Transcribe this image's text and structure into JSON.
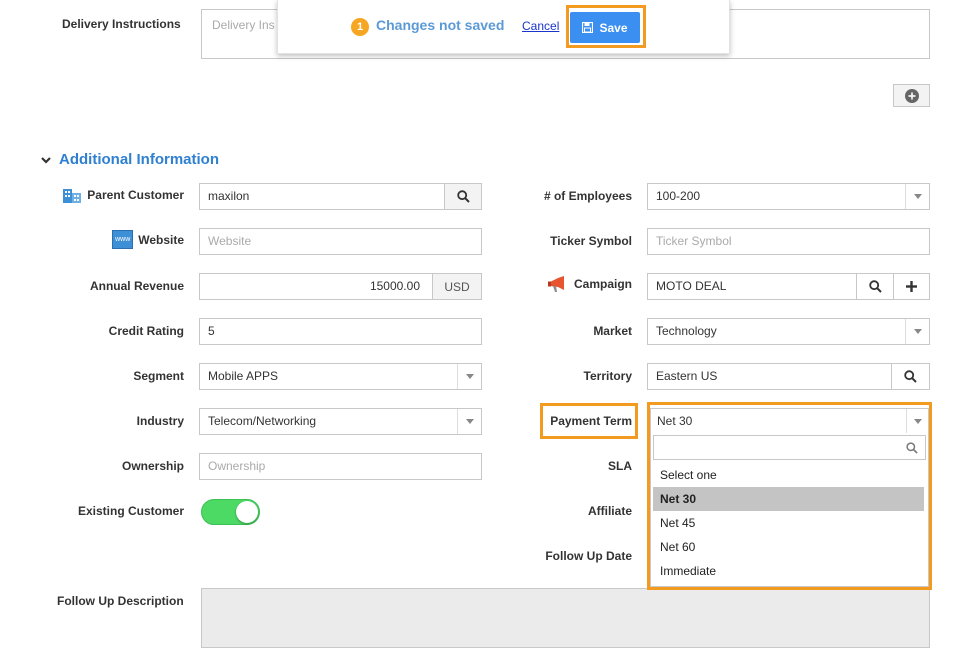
{
  "delivery": {
    "label": "Delivery Instructions",
    "placeholder": "Delivery Ins"
  },
  "unsaved_bar": {
    "badge": "1",
    "message": "Changes not saved",
    "cancel_label": "Cancel",
    "save_label": "Save"
  },
  "section": {
    "title": "Additional Information"
  },
  "left": {
    "parent_customer": {
      "label": "Parent Customer",
      "value": "maxilon"
    },
    "website": {
      "label": "Website",
      "placeholder": "Website",
      "icon_text": "www"
    },
    "annual_revenue": {
      "label": "Annual Revenue",
      "value": "15000.00",
      "currency": "USD"
    },
    "credit_rating": {
      "label": "Credit Rating",
      "value": "5"
    },
    "segment": {
      "label": "Segment",
      "value": "Mobile APPS"
    },
    "industry": {
      "label": "Industry",
      "value": "Telecom/Networking"
    },
    "ownership": {
      "label": "Ownership",
      "placeholder": "Ownership"
    },
    "existing_customer": {
      "label": "Existing Customer",
      "on": true
    },
    "follow_up_description": {
      "label": "Follow Up Description"
    }
  },
  "right": {
    "employees": {
      "label": "# of Employees",
      "value": "100-200"
    },
    "ticker": {
      "label": "Ticker Symbol",
      "placeholder": "Ticker Symbol"
    },
    "campaign": {
      "label": "Campaign",
      "value": "MOTO DEAL"
    },
    "market": {
      "label": "Market",
      "value": "Technology"
    },
    "territory": {
      "label": "Territory",
      "value": "Eastern US"
    },
    "payment_term": {
      "label": "Payment Term",
      "value": "Net 30",
      "options": [
        "Select one",
        "Net 30",
        "Net 45",
        "Net 60",
        "Immediate"
      ],
      "selected_index": 1
    },
    "sla": {
      "label": "SLA"
    },
    "affiliate": {
      "label": "Affiliate"
    },
    "follow_up_date": {
      "label": "Follow Up Date"
    }
  },
  "colors": {
    "accent_blue": "#2f80d1",
    "highlight_orange": "#f39a21",
    "save_blue": "#3b8ff0",
    "toggle_green": "#4cd964"
  }
}
